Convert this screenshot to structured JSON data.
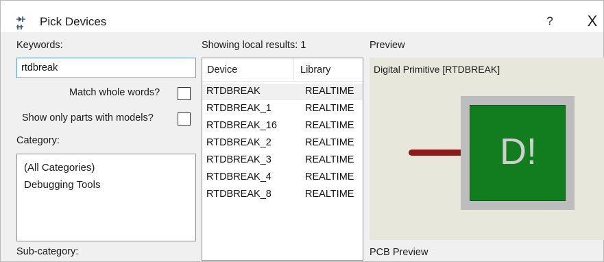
{
  "window": {
    "title": "Pick Devices",
    "help_label": "?",
    "close_label": "X"
  },
  "left": {
    "keywords_label": "Keywords:",
    "keywords_value": "rtdbreak",
    "match_whole_words_label": "Match whole words?",
    "match_whole_words_checked": false,
    "show_models_label": "Show only parts with models?",
    "show_models_checked": false,
    "category_label": "Category:",
    "categories": [
      "(All Categories)",
      "Debugging Tools"
    ],
    "subcategory_label": "Sub-category:"
  },
  "results": {
    "status": "Showing local results: 1",
    "columns": [
      "Device",
      "Library"
    ],
    "rows": [
      {
        "device": "RTDBREAK",
        "library": "REALTIME",
        "selected": true
      },
      {
        "device": "RTDBREAK_1",
        "library": "REALTIME",
        "selected": false
      },
      {
        "device": "RTDBREAK_16",
        "library": "REALTIME",
        "selected": false
      },
      {
        "device": "RTDBREAK_2",
        "library": "REALTIME",
        "selected": false
      },
      {
        "device": "RTDBREAK_3",
        "library": "REALTIME",
        "selected": false
      },
      {
        "device": "RTDBREAK_4",
        "library": "REALTIME",
        "selected": false
      },
      {
        "device": "RTDBREAK_8",
        "library": "REALTIME",
        "selected": false
      }
    ]
  },
  "preview": {
    "label": "Preview",
    "caption": "Digital Primitive [RTDBREAK]",
    "symbol_text": "D!",
    "pcb_label": "PCB Preview"
  }
}
